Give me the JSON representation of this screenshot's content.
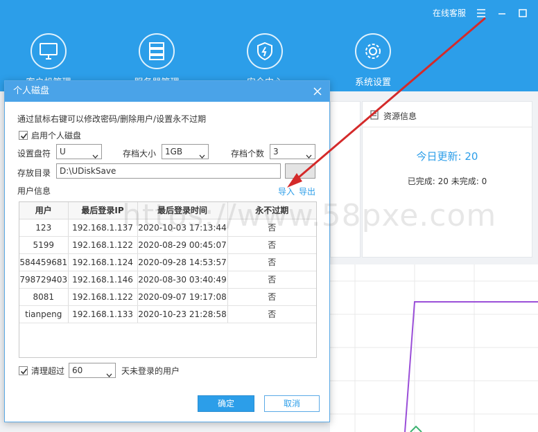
{
  "header": {
    "service_label": "在线客服",
    "nav": [
      {
        "label": "客户机管理",
        "icon": "monitor-icon"
      },
      {
        "label": "服务器管理",
        "icon": "server-icon"
      },
      {
        "label": "安全中心",
        "icon": "shield-icon"
      },
      {
        "label": "系统设置",
        "icon": "gear-icon"
      }
    ]
  },
  "resource": {
    "title": "资源信息",
    "today_update": "今日更新: 20",
    "done_status": "已完成: 20 未完成: 0"
  },
  "dialog": {
    "title": "个人磁盘",
    "hint": "通过鼠标右键可以修改密码/删除用户/设置永不过期",
    "enable_label": "启用个人磁盘",
    "drive_label": "设置盘符",
    "drive_value": "U",
    "size_label": "存档大小",
    "size_value": "1GB",
    "count_label": "存档个数",
    "count_value": "3",
    "dir_label": "存放目录",
    "dir_value": "D:\\UDiskSave",
    "user_info_label": "用户信息",
    "import_label": "导入",
    "export_label": "导出",
    "table": {
      "headers": [
        "用户",
        "最后登录IP",
        "最后登录时间",
        "永不过期"
      ],
      "rows": [
        [
          "123",
          "192.168.1.137",
          "2020-10-03 17:13:44",
          "否"
        ],
        [
          "5199",
          "192.168.1.122",
          "2020-08-29 00:45:07",
          "否"
        ],
        [
          "584459681",
          "192.168.1.124",
          "2020-09-28 14:53:57",
          "否"
        ],
        [
          "798729403",
          "192.168.1.146",
          "2020-08-30 03:40:49",
          "否"
        ],
        [
          "8081",
          "192.168.1.122",
          "2020-09-07 19:17:08",
          "否"
        ],
        [
          "tianpeng",
          "192.168.1.133",
          "2020-10-23 21:28:58",
          "否"
        ]
      ]
    },
    "cleanup_label": "清理超过",
    "cleanup_value": "60",
    "cleanup_suffix": "天未登录的用户",
    "ok_label": "确定",
    "cancel_label": "取消"
  },
  "watermark": "https://www.58pxe.com",
  "colors": {
    "header_bg": "#2c9ee9",
    "dialog_title_bg": "#4aa3e8",
    "accent": "#2c9ee9",
    "annotation_arrow": "#d42a2a",
    "chart_line": "#9a4ed8"
  }
}
